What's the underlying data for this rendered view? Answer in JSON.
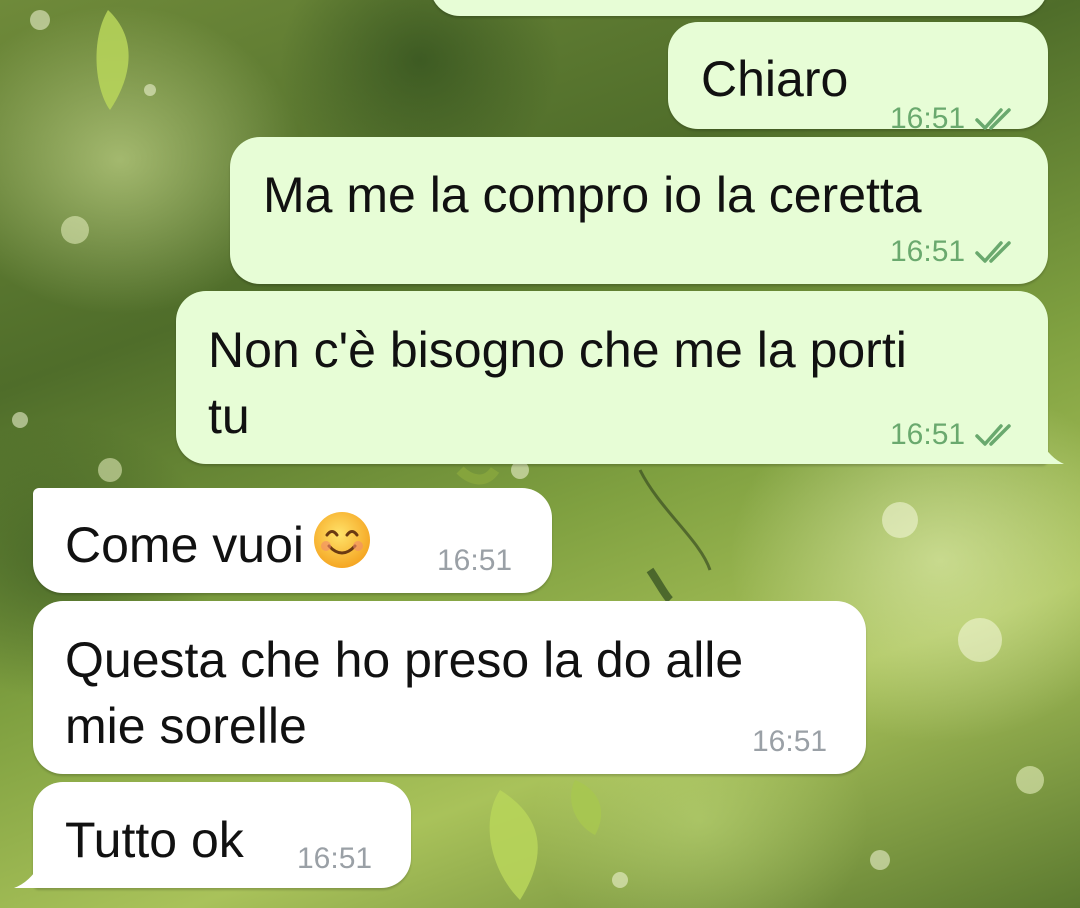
{
  "conversation": {
    "messages": [
      {
        "direction": "outgoing",
        "text_lines": [
          ""
        ],
        "time": "",
        "status": ""
      },
      {
        "direction": "outgoing",
        "text_lines": [
          "Chiaro"
        ],
        "time": "16:51",
        "status": "read-double-check-icon"
      },
      {
        "direction": "outgoing",
        "text_lines": [
          "Ma me la compro io la ceretta"
        ],
        "time": "16:51",
        "status": "read-double-check-icon"
      },
      {
        "direction": "outgoing",
        "text_lines": [
          "Non c'è bisogno che me la porti",
          "tu"
        ],
        "time": "16:51",
        "status": "read-double-check-icon"
      },
      {
        "direction": "incoming",
        "text_lines": [
          "Come vuoi"
        ],
        "emoji": "smiling-face-emoji",
        "time": "16:51"
      },
      {
        "direction": "incoming",
        "text_lines": [
          "Questa che ho preso la do alle",
          "mie sorelle"
        ],
        "time": "16:51"
      },
      {
        "direction": "incoming",
        "text_lines": [
          "Tutto ok"
        ],
        "time": "16:51"
      }
    ]
  },
  "colors": {
    "outgoing_bubble": "#e7fdd6",
    "incoming_bubble": "#ffffff",
    "outgoing_time": "#6aa96e",
    "incoming_time": "#9aa0a6",
    "read_ticks": "#6aa96e"
  }
}
